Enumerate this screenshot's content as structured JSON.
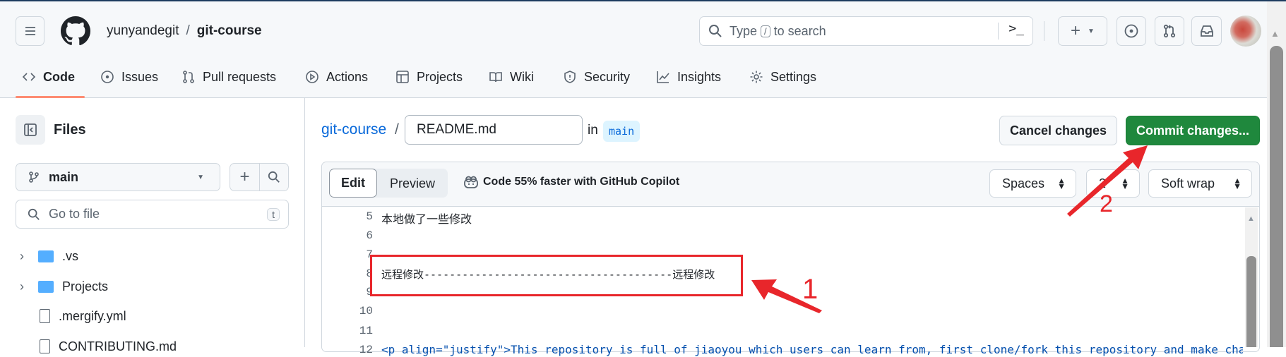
{
  "header": {
    "owner": "yunyandegit",
    "separator": "/",
    "repo": "git-course",
    "search_placeholder_pre": "Type",
    "search_key": "/",
    "search_placeholder_post": "to search"
  },
  "nav": [
    {
      "label": "Code",
      "active": true
    },
    {
      "label": "Issues"
    },
    {
      "label": "Pull requests"
    },
    {
      "label": "Actions"
    },
    {
      "label": "Projects"
    },
    {
      "label": "Wiki"
    },
    {
      "label": "Security"
    },
    {
      "label": "Insights"
    },
    {
      "label": "Settings"
    }
  ],
  "sidebar": {
    "title": "Files",
    "branch": "main",
    "go_to_file_placeholder": "Go to file",
    "go_to_file_key": "t",
    "tree": [
      {
        "name": ".vs",
        "type": "folder"
      },
      {
        "name": "Projects",
        "type": "folder"
      },
      {
        "name": ".mergify.yml",
        "type": "file"
      },
      {
        "name": "CONTRIBUTING.md",
        "type": "file"
      }
    ]
  },
  "editor": {
    "repo_link": "git-course",
    "separator": "/",
    "filename": "README.md",
    "in_label": "in",
    "branch": "main",
    "cancel_label": "Cancel changes",
    "commit_label": "Commit changes...",
    "tab_edit": "Edit",
    "tab_preview": "Preview",
    "copilot_text": "Code 55% faster with GitHub Copilot",
    "indent_mode": "Spaces",
    "indent_size": "2",
    "wrap_mode": "Soft wrap",
    "lines": [
      {
        "n": "5",
        "text": "本地做了一些修改"
      },
      {
        "n": "6",
        "text": ""
      },
      {
        "n": "7",
        "text": ""
      },
      {
        "n": "8",
        "text": "远程修改---------------------------------------远程修改"
      },
      {
        "n": "9",
        "text": ""
      },
      {
        "n": "10",
        "text": ""
      },
      {
        "n": "11",
        "text": ""
      },
      {
        "n": "12",
        "text": "<p align=\"justify\">This repository is full of jiaoyou which users can learn from, first clone/fork this repository and make changes"
      }
    ]
  },
  "annotations": {
    "label1": "1",
    "label2": "2",
    "color": "#e8262b"
  },
  "colors": {
    "accent": "#0969da",
    "commit_green": "#1f883d",
    "active_tab": "#fd8c73"
  }
}
